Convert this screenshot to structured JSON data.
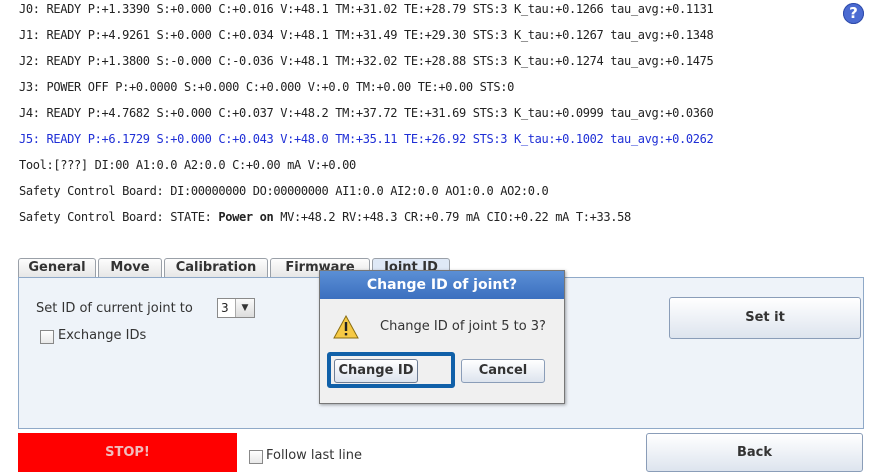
{
  "log": {
    "lines": [
      "J0: READY P:+1.3390 S:+0.000 C:+0.016 V:+48.1 TM:+31.02 TE:+28.79 STS:3 K_tau:+0.1266 tau_avg:+0.1131",
      "J1: READY P:+4.9261 S:+0.000 C:+0.034 V:+48.1 TM:+31.49 TE:+29.30 STS:3 K_tau:+0.1267 tau_avg:+0.1348",
      "J2: READY P:+1.3800 S:-0.000 C:-0.036 V:+48.1 TM:+32.02 TE:+28.88 STS:3 K_tau:+0.1274 tau_avg:+0.1475",
      "J3: POWER OFF P:+0.0000 S:+0.000 C:+0.000 V:+0.0 TM:+0.00 TE:+0.00 STS:0",
      "J4: READY P:+4.7682 S:+0.000 C:+0.037 V:+48.2 TM:+37.72 TE:+31.69 STS:3 K_tau:+0.0999 tau_avg:+0.0360",
      "J5: READY P:+6.1729 S:+0.000 C:+0.043 V:+48.0 TM:+35.11 TE:+26.92 STS:3 K_tau:+0.1002 tau_avg:+0.0262",
      "Tool:[???] DI:00  A1:0.0 A2:0.0 C:+0.00 mA V:+0.00",
      "Safety Control Board: DI:00000000 DO:00000000 AI1:0.0 AI2:0.0 AO1:0.0 AO2:0.0"
    ],
    "state_line": {
      "prefix": "Safety Control Board: STATE: ",
      "state": "Power on",
      "suffix": " MV:+48.2 RV:+48.3 CR:+0.79 mA CIO:+0.22 mA T:+33.58"
    },
    "highlight_color": "#1f2fd6"
  },
  "help_label": "?",
  "tabs": [
    "General",
    "Move",
    "Calibration",
    "Firmware",
    "Joint ID"
  ],
  "active_tab": "Joint ID",
  "joint_id": {
    "set_label": "Set ID of current joint to",
    "selected_value": "3",
    "exchange_label": "Exchange IDs",
    "set_button": "Set it"
  },
  "footer": {
    "stop_label": "STOP!",
    "follow_label": "Follow last line",
    "back_label": "Back"
  },
  "dialog": {
    "title": "Change ID of joint?",
    "message": "Change ID of joint 5 to 3?",
    "confirm_label": "Change ID",
    "cancel_label": "Cancel"
  }
}
